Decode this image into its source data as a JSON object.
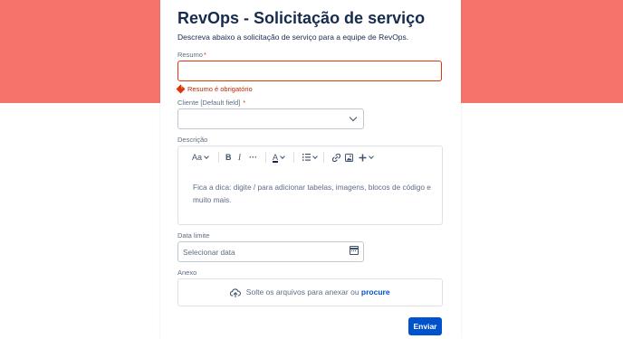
{
  "form": {
    "title": "RevOps - Solicitação de serviço",
    "subtitle": "Descreva abaixo a solicitação de serviço para a equipe de RevOps."
  },
  "fields": {
    "resumo": {
      "label": "Resumo",
      "required_mark": "*",
      "error": "Resumo é obrigatório",
      "value": ""
    },
    "cliente": {
      "label": "Cliente [Default field]",
      "required_mark": "*",
      "value": ""
    },
    "descricao": {
      "label": "Descrição",
      "toolbar": {
        "text_style": "Aa",
        "bold": "B",
        "italic": "I",
        "more": "···",
        "text_color": "A"
      },
      "hint": "Fica a dica: digite / para adicionar tabelas, imagens, blocos de código e muito mais."
    },
    "data_limite": {
      "label": "Data limite",
      "placeholder": "Selecionar data"
    },
    "anexo": {
      "label": "Anexo",
      "drop_text": "Solte os arquivos para anexar ou",
      "browse_link": "procure"
    }
  },
  "actions": {
    "submit_label": "Enviar"
  },
  "colors": {
    "banner": "#f6736b",
    "primary": "#0052cc",
    "error": "#de350b"
  }
}
